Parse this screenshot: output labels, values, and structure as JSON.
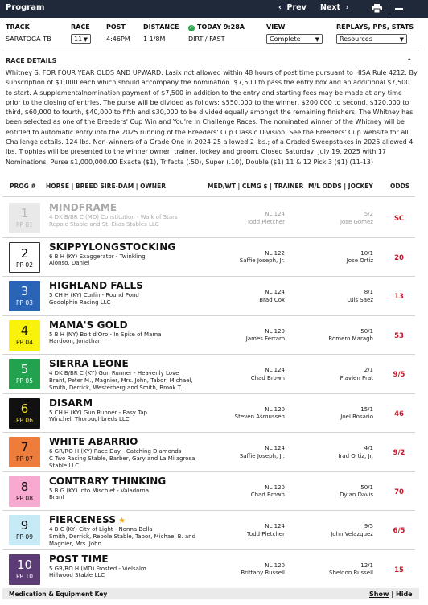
{
  "toolbar": {
    "title": "Program",
    "prev_label": "Prev",
    "next_label": "Next"
  },
  "race_info": {
    "track_header": "TRACK",
    "track_value": "SARATOGA TB",
    "race_header": "RACE",
    "race_value": "11",
    "post_header": "POST",
    "post_value": "4:46PM",
    "distance_header": "DISTANCE",
    "distance_value": "1 1/8M",
    "today_header": "TODAY 9:28A",
    "today_value": "DIRT / FAST",
    "view_header": "VIEW",
    "view_value": "Complete",
    "replays_header": "REPLAYS, PPS, STATS",
    "replays_value": "Resources"
  },
  "race_details": {
    "title": "RACE DETAILS",
    "text": "Whitney S. FOR FOUR YEAR OLDS AND UPWARD. Lasix not allowed within 48 hours of post time pursuant to HISA Rule 4212. By subscription of $1,000 each which should accompany the nomination. $7,500 to pass the entry box and an additional $7,500 to start. A supplementalnomination payment of $7,500 in addition to the entry and starting fees may be made at any time prior to the closing of entries. The purse will be divided as follows: $550,000 to the winner, $200,000 to second, $120,000 to third, $60,000 to fourth, $40,000 to fifth and $30,000 to be divided equally amongst the remaining finishers. The Whitney has been selected as one of the Breeders' Cup Win and You're In Challenge Races. The nominated winner of the Whitney will be entitled to automatic entry into the 2025 running of the Breeders' Cup Classic Division. See the Breeders' Cup website for all Challenge details. 124 lbs. Non-winners of a Grade One in 2024-25 allowed 2 lbs.; of a Graded Sweepstakes in 2025 allowed 4 lbs. Trophies will be presented to the winner owner, trainer, jockey and groom. Closed Saturday, July 19, 2025 with 17 Nominations. Purse $1,000,000.00 Exacta ($1), Trifecta (.50), Super (.10), Double ($1) 11 & 12 Pick 3 ($1) (11-13)"
  },
  "columns": {
    "prog": "PROG #",
    "horse": "HORSE | BREED SIRE-DAM | OWNER",
    "medwt": "MED/WT | CLMG $ | TRAINER",
    "ml": "M/L ODDS | JOCKEY",
    "odds": "ODDS"
  },
  "horses": [
    {
      "prog": "1",
      "pp": "PP 01",
      "name": "MINDFRAME",
      "detail1": "4 DK B/BR C (MD) Constitution - Walk of Stars",
      "detail2": "Repole Stable and St. Elias Stables LLC",
      "medwt": "NL 124",
      "trainer": "Todd Pletcher",
      "ml": "5/2",
      "jockey": "Jose Gomez",
      "odds": "SC",
      "bg": "#e9e9e9",
      "fg": "#bbbbbb",
      "scratched": true
    },
    {
      "prog": "2",
      "pp": "PP 02",
      "name": "SKIPPYLONGSTOCKING",
      "detail1": "6 B H (KY) Exaggerator - Twinkling",
      "detail2": "Alonso, Daniel",
      "medwt": "NL 122",
      "trainer": "Saffie Joseph, Jr.",
      "ml": "10/1",
      "jockey": "Jose Ortiz",
      "odds": "20",
      "bg": "#ffffff",
      "fg": "#111111",
      "border": "#333333"
    },
    {
      "prog": "3",
      "pp": "PP 03",
      "name": "HIGHLAND FALLS",
      "detail1": "5 CH H (KY) Curlin - Round Pond",
      "detail2": "Godolphin Racing LLC",
      "medwt": "NL 124",
      "trainer": "Brad Cox",
      "ml": "8/1",
      "jockey": "Luis Saez",
      "odds": "13",
      "bg": "#2a64b7",
      "fg": "#ffffff"
    },
    {
      "prog": "4",
      "pp": "PP 04",
      "name": "MAMA'S GOLD",
      "detail1": "5 B H (NY) Bolt d'Oro - In Spite of Mama",
      "detail2": "Hardoon, Jonathan",
      "medwt": "NL 120",
      "trainer": "James Ferraro",
      "ml": "50/1",
      "jockey": "Romero Maragh",
      "odds": "53",
      "bg": "#f8f20d",
      "fg": "#111111"
    },
    {
      "prog": "5",
      "pp": "PP 05",
      "name": "SIERRA LEONE",
      "detail1": "4 DK B/BR C (KY) Gun Runner - Heavenly Love",
      "detail2": "Brant, Peter M., Magnier, Mrs. John, Tabor, Michael, Smith, Derrick, Westerberg and Smith, Brook T.",
      "medwt": "NL 124",
      "trainer": "Chad Brown",
      "ml": "2/1",
      "jockey": "Flavien Prat",
      "odds": "9/5",
      "bg": "#22a24e",
      "fg": "#ffffff"
    },
    {
      "prog": "6",
      "pp": "PP 06",
      "name": "DISARM",
      "detail1": "5 CH H (KY) Gun Runner - Easy Tap",
      "detail2": "Winchell Thoroughbreds LLC",
      "medwt": "NL 120",
      "trainer": "Steven Asmussen",
      "ml": "15/1",
      "jockey": "Joel Rosario",
      "odds": "46",
      "bg": "#111111",
      "fg": "#f4e21a"
    },
    {
      "prog": "7",
      "pp": "PP 07",
      "name": "WHITE ABARRIO",
      "detail1": "6 GR/RO H (KY) Race Day - Catching Diamonds",
      "detail2": "C Two Racing Stable, Barber, Gary and La Milagrosa Stable LLC",
      "medwt": "NL 124",
      "trainer": "Saffie Joseph, Jr.",
      "ml": "4/1",
      "jockey": "Irad Ortiz, Jr.",
      "odds": "9/2",
      "bg": "#ee7d3c",
      "fg": "#111111"
    },
    {
      "prog": "8",
      "pp": "PP 08",
      "name": "CONTRARY THINKING",
      "detail1": "5 B G (KY) Into Mischief - Valadorna",
      "detail2": "Brant",
      "medwt": "NL 120",
      "trainer": "Chad Brown",
      "ml": "50/1",
      "jockey": "Dylan Davis",
      "odds": "70",
      "bg": "#f7a9cf",
      "fg": "#111111"
    },
    {
      "prog": "9",
      "pp": "PP 09",
      "name": "FIERCENESS",
      "detail1": "4 B C (KY) City of Light - Nonna Bella",
      "detail2": "Smith, Derrick, Repole Stable, Tabor, Michael B. and Magnier, Mrs. John",
      "medwt": "NL 124",
      "trainer": "Todd Pletcher",
      "ml": "9/5",
      "jockey": "John Velazquez",
      "odds": "6/5",
      "bg": "#c7ebf6",
      "fg": "#111111",
      "star": true
    },
    {
      "prog": "10",
      "pp": "PP 10",
      "name": "POST TIME",
      "detail1": "5 GR/RO H (MD) Frosted - Vielsalm",
      "detail2": "Hillwood Stable LLC",
      "medwt": "NL 120",
      "trainer": "Brittany Russell",
      "ml": "12/1",
      "jockey": "Sheldon Russell",
      "odds": "15",
      "bg": "#5b3c74",
      "fg": "#ffffff"
    }
  ],
  "footer": {
    "label": "Medication & Equipment Key",
    "show": "Show",
    "separator": "|",
    "hide": "Hide"
  }
}
